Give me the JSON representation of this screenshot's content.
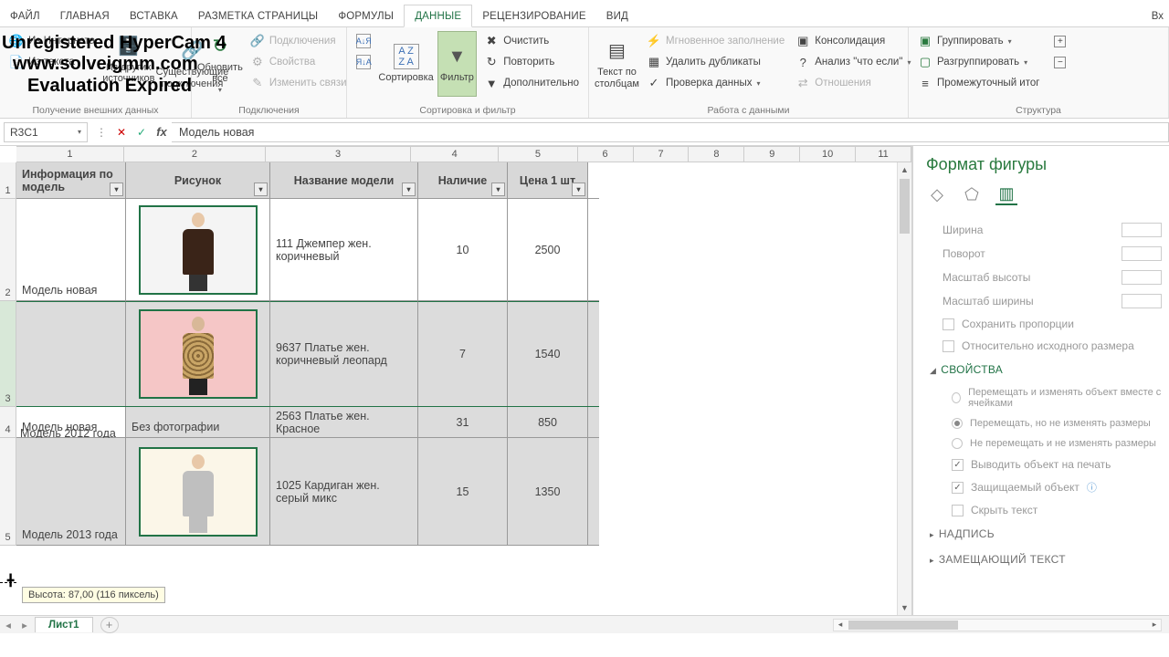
{
  "watermark": {
    "line1": "Unregistered HyperCam 4",
    "line2": "www.solveigmm.com",
    "line3": "Evaluation Expired"
  },
  "ribbonTabs": {
    "items": [
      "ФАЙЛ",
      "ГЛАВНАЯ",
      "ВСТАВКА",
      "РАЗМЕТКА СТРАНИЦЫ",
      "ФОРМУЛЫ",
      "ДАННЫЕ",
      "РЕЦЕНЗИРОВАНИЕ",
      "ВИД"
    ],
    "activeIndex": 5,
    "right": "Вх"
  },
  "ribbon": {
    "getExternal": {
      "fromWeb": "Из Интернета",
      "fromText": "Из текста",
      "fromOther": "Из других источников",
      "existing": "Существующие подключения",
      "label": "Получение внешних данных"
    },
    "connections": {
      "refresh": "Обновить все",
      "conns": "Подключения",
      "props": "Свойства",
      "editLinks": "Изменить связи",
      "label": "Подключения"
    },
    "sortFilter": {
      "sort": "Сортировка",
      "filter": "Фильтр",
      "clear": "Очистить",
      "reapply": "Повторить",
      "advanced": "Дополнительно",
      "label": "Сортировка и фильтр"
    },
    "dataTools": {
      "textToCols": "Текст по столбцам",
      "flash": "Мгновенное заполнение",
      "removeDup": "Удалить дубликаты",
      "validation": "Проверка данных",
      "consolidate": "Консолидация",
      "whatIf": "Анализ \"что если\"",
      "relations": "Отношения",
      "label": "Работа с данными"
    },
    "outline": {
      "group": "Группировать",
      "ungroup": "Разгруппировать",
      "subtotal": "Промежуточный итог",
      "label": "Структура"
    }
  },
  "formulaBar": {
    "nameBox": "R3C1",
    "value": "Модель новая"
  },
  "cols": [
    "1",
    "2",
    "3",
    "4",
    "5",
    "6",
    "7",
    "8",
    "9",
    "10",
    "11"
  ],
  "rowNums": [
    "1",
    "2",
    "3",
    "4",
    "5"
  ],
  "headers": {
    "c1": "Информация по модель",
    "c2": "Рисунок",
    "c3": "Название модели",
    "c4": "Наличие",
    "c5": "Цена 1 шт"
  },
  "rows": [
    {
      "info": "Модель новая",
      "name": "111 Джемпер жен. коричневый",
      "stock": "10",
      "price": "2500",
      "photoType": "brown"
    },
    {
      "info": "Модель новая",
      "name": "9637 Платье жен. коричневый леопард",
      "stock": "7",
      "price": "1540",
      "photoType": "leopard"
    },
    {
      "info": "Модель 2012 года",
      "photoLabel": "Без фотографии",
      "name": "2563 Платье жен. Красное",
      "stock": "31",
      "price": "850",
      "photoType": "none"
    },
    {
      "info": "Модель 2013 года",
      "name": "1025 Кардиган жен. серый микс",
      "stock": "15",
      "price": "1350",
      "photoType": "grey"
    }
  ],
  "tooltip": "Высота: 87,00 (116 пиксель)",
  "pane": {
    "title": "Формат фигуры",
    "size": {
      "width": "Ширина",
      "rotation": "Поворот",
      "scaleH": "Масштаб высоты",
      "scaleW": "Масштаб ширины",
      "lockRatio": "Сохранить пропорции",
      "relative": "Относительно исходного размера"
    },
    "props": {
      "title": "СВОЙСТВА",
      "opt1": "Перемещать и изменять объект вместе с ячейками",
      "opt2": "Перемещать, но не изменять размеры",
      "opt3": "Не перемещать и не изменять размеры",
      "print": "Выводить объект на печать",
      "locked": "Защищаемый объект",
      "hideText": "Скрыть текст"
    },
    "caption": "НАДПИСЬ",
    "altText": "ЗАМЕЩАЮЩИЙ ТЕКСТ"
  },
  "sheet": {
    "name": "Лист1"
  }
}
